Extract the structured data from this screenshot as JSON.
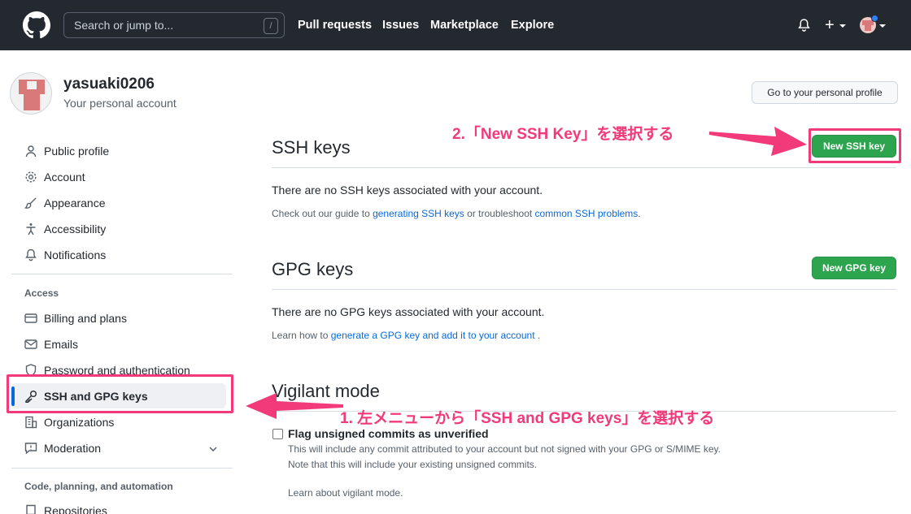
{
  "header": {
    "search_placeholder": "Search or jump to...",
    "search_shortcut": "/",
    "nav": [
      "Pull requests",
      "Issues",
      "Marketplace",
      "Explore"
    ],
    "plus_label": "+"
  },
  "account": {
    "username": "yasuaki0206",
    "subtitle": "Your personal account",
    "profile_button": "Go to your personal profile"
  },
  "sidebar": {
    "items_top": [
      "Public profile",
      "Account",
      "Appearance",
      "Accessibility",
      "Notifications"
    ],
    "access_heading": "Access",
    "items_access": [
      "Billing and plans",
      "Emails",
      "Password and authentication",
      "SSH and GPG keys",
      "Organizations",
      "Moderation"
    ],
    "code_heading": "Code, planning, and automation",
    "items_code": [
      "Repositories"
    ],
    "active": "SSH and GPG keys"
  },
  "ssh": {
    "title": "SSH keys",
    "button": "New SSH key",
    "empty": "There are no SSH keys associated with your account.",
    "help_prefix": "Check out our guide to ",
    "help_link1": "generating SSH keys",
    "help_mid": " or troubleshoot ",
    "help_link2": "common SSH problems",
    "help_suffix": "."
  },
  "gpg": {
    "title": "GPG keys",
    "button": "New GPG key",
    "empty": "There are no GPG keys associated with your account.",
    "help_prefix": "Learn how to ",
    "help_link": "generate a GPG key and add it to your account",
    "help_suffix": " ."
  },
  "vigilant": {
    "title": "Vigilant mode",
    "checkbox_label": "Flag unsigned commits as unverified",
    "note1": "This will include any commit attributed to your account but not signed with your GPG or S/MIME key.",
    "note2": "Note that this will include your existing unsigned commits.",
    "link": "Learn about vigilant mode."
  },
  "annotations": {
    "step1": "1. 左メニューから「SSH and GPG keys」を選択する",
    "step2": "2.「New SSH Key」を選択する"
  },
  "colors": {
    "header_bg": "#24292f",
    "primary_button": "#2da44e",
    "link": "#0969da",
    "annotation": "#f23a7a"
  }
}
